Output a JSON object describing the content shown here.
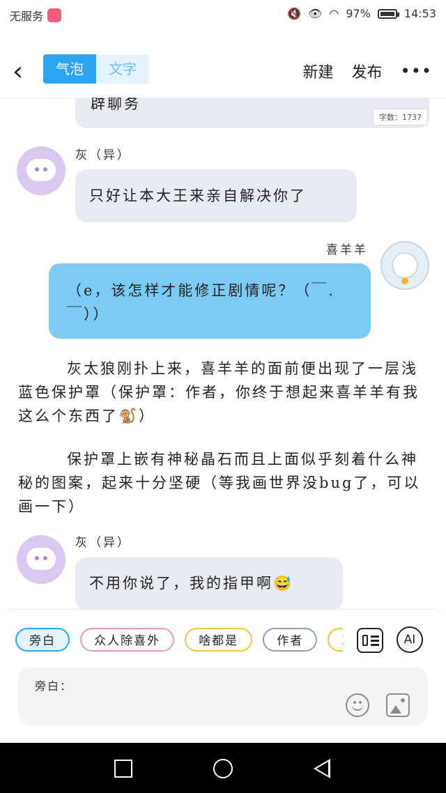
{
  "status": {
    "carrier": "无服务",
    "battery": "97%",
    "time": "14:53"
  },
  "topbar": {
    "tab_bubble": "气泡",
    "tab_text": "文字",
    "new_label": "新建",
    "publish_label": "发布",
    "more": "•••"
  },
  "messages": {
    "partial_text": "辟聊务",
    "word_count": "字数：1737",
    "m1_name": "灰（异）",
    "m1_text": "只好让本大王来亲自解决你了",
    "m2_name": "喜羊羊",
    "m2_text": "（e，该怎样才能修正剧情呢？（￣.￣））",
    "narr1": "灰太狼刚扑上来，喜羊羊的面前便出现了一层浅蓝色保护罩（保护罩：作者，你终于想起来喜羊羊有我这么个东西了🐒）",
    "narr2": "保护罩上嵌有神秘晶石而且上面似乎刻着什么神秘的图案，起来十分坚硬（等我画世界没bug了，可以画一下）",
    "m3_name": "灰（异）",
    "m3_text": "不用你说了，我的指甲啊😅"
  },
  "roles": [
    "旁白",
    "众人除喜外",
    "啥都是",
    "作者",
    "灰"
  ],
  "ai_label": "AI",
  "input": {
    "label": "旁白："
  }
}
